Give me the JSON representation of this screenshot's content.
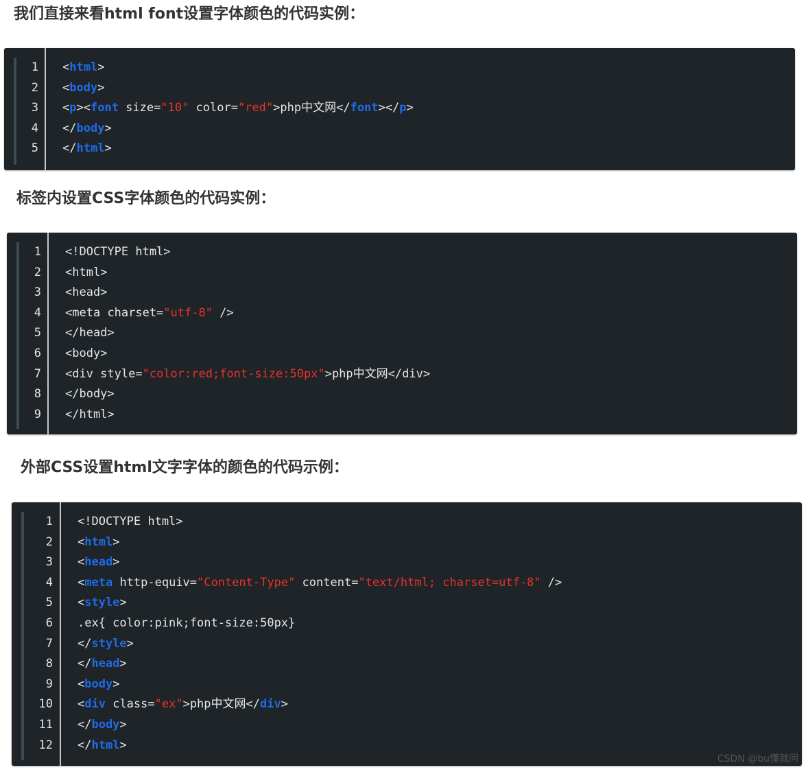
{
  "headings": [
    "我们直接来看html font设置字体颜色的代码实例：",
    "标签内设置CSS字体颜色的代码实例：",
    "外部CSS设置html文字字体的颜色的代码示例："
  ],
  "code_blocks": [
    {
      "lines": [
        {
          "n": "1",
          "tokens": [
            {
              "t": "<",
              "c": "plain"
            },
            {
              "t": "html",
              "c": "tag"
            },
            {
              "t": ">",
              "c": "plain"
            }
          ]
        },
        {
          "n": "2",
          "tokens": [
            {
              "t": "<",
              "c": "plain"
            },
            {
              "t": "body",
              "c": "tag"
            },
            {
              "t": ">",
              "c": "plain"
            }
          ]
        },
        {
          "n": "3",
          "tokens": [
            {
              "t": "<",
              "c": "plain"
            },
            {
              "t": "p",
              "c": "tag"
            },
            {
              "t": "><",
              "c": "plain"
            },
            {
              "t": "font",
              "c": "tag"
            },
            {
              "t": " size=",
              "c": "plain"
            },
            {
              "t": "\"10\"",
              "c": "str"
            },
            {
              "t": " color=",
              "c": "plain"
            },
            {
              "t": "\"red\"",
              "c": "str"
            },
            {
              "t": ">php中文网</",
              "c": "plain"
            },
            {
              "t": "font",
              "c": "tag"
            },
            {
              "t": "></",
              "c": "plain"
            },
            {
              "t": "p",
              "c": "tag"
            },
            {
              "t": ">",
              "c": "plain"
            }
          ]
        },
        {
          "n": "4",
          "tokens": [
            {
              "t": "</",
              "c": "plain"
            },
            {
              "t": "body",
              "c": "tag"
            },
            {
              "t": ">",
              "c": "plain"
            }
          ]
        },
        {
          "n": "5",
          "tokens": [
            {
              "t": "</",
              "c": "plain"
            },
            {
              "t": "html",
              "c": "tag"
            },
            {
              "t": ">",
              "c": "plain"
            }
          ]
        }
      ]
    },
    {
      "lines": [
        {
          "n": "1",
          "tokens": [
            {
              "t": "<!DOCTYPE html>",
              "c": "plain"
            }
          ]
        },
        {
          "n": "2",
          "tokens": [
            {
              "t": "<html>",
              "c": "plain"
            }
          ]
        },
        {
          "n": "3",
          "tokens": [
            {
              "t": "<head>",
              "c": "plain"
            }
          ]
        },
        {
          "n": "4",
          "tokens": [
            {
              "t": "<meta charset=",
              "c": "plain"
            },
            {
              "t": "\"utf-8\"",
              "c": "str"
            },
            {
              "t": " />",
              "c": "plain"
            }
          ]
        },
        {
          "n": "5",
          "tokens": [
            {
              "t": "</head>",
              "c": "plain"
            }
          ]
        },
        {
          "n": "6",
          "tokens": [
            {
              "t": "<body>",
              "c": "plain"
            }
          ]
        },
        {
          "n": "7",
          "tokens": [
            {
              "t": "<div style=",
              "c": "plain"
            },
            {
              "t": "\"color:red;font-size:50px\"",
              "c": "str"
            },
            {
              "t": ">php中文网</div>",
              "c": "plain"
            }
          ]
        },
        {
          "n": "8",
          "tokens": [
            {
              "t": "</body>",
              "c": "plain"
            }
          ]
        },
        {
          "n": "9",
          "tokens": [
            {
              "t": "</html>",
              "c": "plain"
            }
          ]
        }
      ]
    },
    {
      "lines": [
        {
          "n": "1",
          "tokens": [
            {
              "t": "<!DOCTYPE html>",
              "c": "plain"
            }
          ]
        },
        {
          "n": "2",
          "tokens": [
            {
              "t": "<",
              "c": "plain"
            },
            {
              "t": "html",
              "c": "tag"
            },
            {
              "t": ">",
              "c": "plain"
            }
          ]
        },
        {
          "n": "3",
          "tokens": [
            {
              "t": "<",
              "c": "plain"
            },
            {
              "t": "head",
              "c": "tag"
            },
            {
              "t": ">",
              "c": "plain"
            }
          ]
        },
        {
          "n": "4",
          "tokens": [
            {
              "t": "<",
              "c": "plain"
            },
            {
              "t": "meta",
              "c": "tag"
            },
            {
              "t": " http-equiv=",
              "c": "plain"
            },
            {
              "t": "\"Content-Type\"",
              "c": "str"
            },
            {
              "t": " content=",
              "c": "plain"
            },
            {
              "t": "\"text/html; charset=utf-8\"",
              "c": "str"
            },
            {
              "t": " />",
              "c": "plain"
            }
          ]
        },
        {
          "n": "5",
          "tokens": [
            {
              "t": "<",
              "c": "plain"
            },
            {
              "t": "style",
              "c": "tag"
            },
            {
              "t": ">",
              "c": "plain"
            }
          ]
        },
        {
          "n": "6",
          "tokens": [
            {
              "t": ".ex{ color:pink;font-size:50px}",
              "c": "plain"
            }
          ]
        },
        {
          "n": "7",
          "tokens": [
            {
              "t": "</",
              "c": "plain"
            },
            {
              "t": "style",
              "c": "tag"
            },
            {
              "t": ">",
              "c": "plain"
            }
          ]
        },
        {
          "n": "8",
          "tokens": [
            {
              "t": "</",
              "c": "plain"
            },
            {
              "t": "head",
              "c": "tag"
            },
            {
              "t": ">",
              "c": "plain"
            }
          ]
        },
        {
          "n": "9",
          "tokens": [
            {
              "t": "<",
              "c": "plain"
            },
            {
              "t": "body",
              "c": "tag"
            },
            {
              "t": ">",
              "c": "plain"
            }
          ]
        },
        {
          "n": "10",
          "tokens": [
            {
              "t": "<",
              "c": "plain"
            },
            {
              "t": "div",
              "c": "tag"
            },
            {
              "t": " class=",
              "c": "plain"
            },
            {
              "t": "\"ex\"",
              "c": "str"
            },
            {
              "t": ">php中文网</",
              "c": "plain"
            },
            {
              "t": "div",
              "c": "tag"
            },
            {
              "t": ">",
              "c": "plain"
            }
          ]
        },
        {
          "n": "11",
          "tokens": [
            {
              "t": "</",
              "c": "plain"
            },
            {
              "t": "body",
              "c": "tag"
            },
            {
              "t": ">",
              "c": "plain"
            }
          ]
        },
        {
          "n": "12",
          "tokens": [
            {
              "t": "</",
              "c": "plain"
            },
            {
              "t": "html",
              "c": "tag"
            },
            {
              "t": ">",
              "c": "plain"
            }
          ]
        }
      ]
    }
  ],
  "watermark": "CSDN @bu懂就问",
  "colors": {
    "code_background": "#1e2428",
    "tag": "#1f6be8",
    "string": "#e8322b",
    "plain_text": "#e6e6e6",
    "gutter_bar": "#3d4c52",
    "heading_text": "#333333"
  }
}
